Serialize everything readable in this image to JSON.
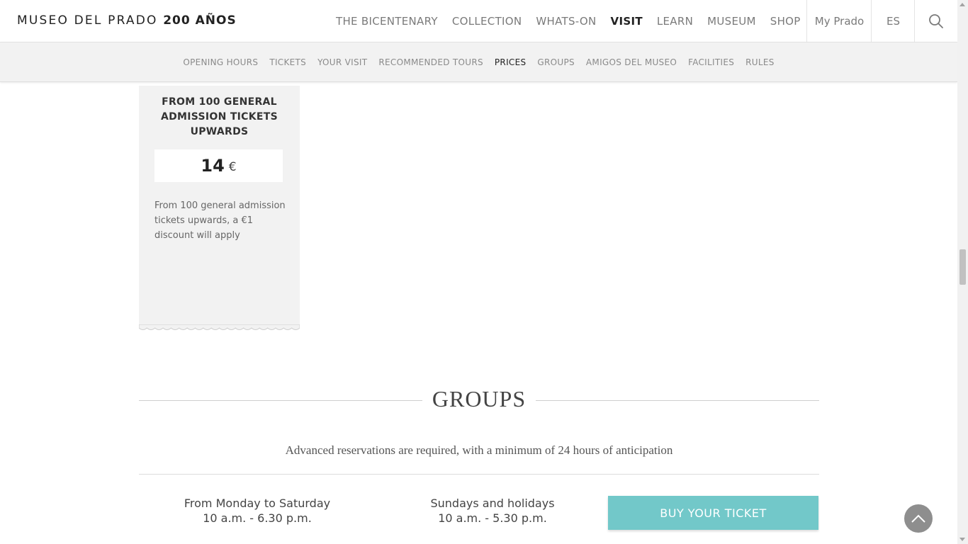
{
  "header": {
    "logo_main": "MUSEO DEL PRADO",
    "logo_bold": "200 AÑOS",
    "nav": [
      {
        "label": "THE BICENTENARY",
        "active": false
      },
      {
        "label": "COLLECTION",
        "active": false
      },
      {
        "label": "WHATS-ON",
        "active": false
      },
      {
        "label": "VISIT",
        "active": true
      },
      {
        "label": "LEARN",
        "active": false
      },
      {
        "label": "MUSEUM",
        "active": false
      },
      {
        "label": "SHOP",
        "active": false
      }
    ],
    "my_prado": "My Prado",
    "language": "ES",
    "search_icon": "search-icon"
  },
  "subnav": [
    {
      "label": "OPENING HOURS",
      "active": false
    },
    {
      "label": "TICKETS",
      "active": false
    },
    {
      "label": "YOUR VISIT",
      "active": false
    },
    {
      "label": "RECOMMENDED TOURS",
      "active": false
    },
    {
      "label": "PRICES",
      "active": true
    },
    {
      "label": "GROUPS",
      "active": false
    },
    {
      "label": "AMIGOS DEL MUSEO",
      "active": false
    },
    {
      "label": "FACILITIES",
      "active": false
    },
    {
      "label": "RULES",
      "active": false
    }
  ],
  "ticket_card": {
    "title": "FROM 100 GENERAL ADMISSION TICKETS UPWARDS",
    "price": "14",
    "currency": "€",
    "description": "From 100 general admission tickets upwards, a €1 discount will apply"
  },
  "groups": {
    "title": "GROUPS",
    "subtitle": "Advanced reservations are required, with a minimum of 24 hours of anticipation",
    "schedule": [
      {
        "days": "From Monday to Saturday",
        "hours": "10 a.m. - 6.30 p.m."
      },
      {
        "days": "Sundays and holidays",
        "hours": "10 a.m. - 5.30 p.m."
      }
    ],
    "buy_button": "BUY YOUR TICKET"
  },
  "colors": {
    "accent": "#72c8c9",
    "subnav_bg": "#f2f2f2",
    "back_to_top": "#8e8e8e"
  },
  "icons": {
    "back_to_top": "chevron-up-icon"
  }
}
